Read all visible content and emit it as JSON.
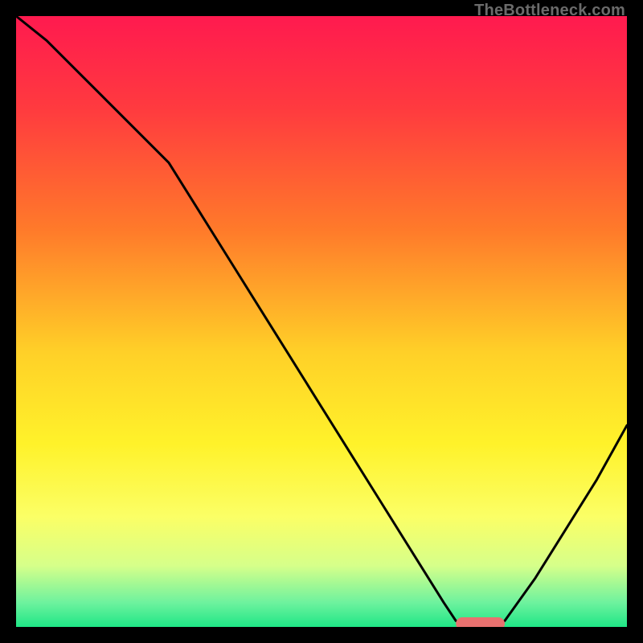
{
  "watermark": "TheBottleneck.com",
  "chart_data": {
    "type": "line",
    "title": "",
    "xlabel": "",
    "ylabel": "",
    "xlim": [
      0,
      100
    ],
    "ylim": [
      0,
      100
    ],
    "gradient_stops": [
      {
        "offset": 0.0,
        "color": "#ff1a4f"
      },
      {
        "offset": 0.15,
        "color": "#ff3a3f"
      },
      {
        "offset": 0.35,
        "color": "#ff7a2a"
      },
      {
        "offset": 0.55,
        "color": "#ffd028"
      },
      {
        "offset": 0.7,
        "color": "#fff22a"
      },
      {
        "offset": 0.82,
        "color": "#fbff66"
      },
      {
        "offset": 0.9,
        "color": "#d6ff8a"
      },
      {
        "offset": 0.96,
        "color": "#6ef29e"
      },
      {
        "offset": 1.0,
        "color": "#1fe686"
      }
    ],
    "series": [
      {
        "name": "bottleneck-curve",
        "color": "#000000",
        "x": [
          0,
          5,
          10,
          15,
          20,
          25,
          30,
          35,
          40,
          45,
          50,
          55,
          60,
          65,
          70,
          72,
          75,
          78,
          80,
          85,
          90,
          95,
          100
        ],
        "y": [
          100,
          96,
          91,
          86,
          81,
          76,
          68,
          60,
          52,
          44,
          36,
          28,
          20,
          12,
          4,
          1,
          0,
          0,
          1,
          8,
          16,
          24,
          33
        ]
      }
    ],
    "marker": {
      "name": "optimal-range",
      "shape": "pill",
      "color": "#e8716f",
      "x_start": 72,
      "x_end": 80,
      "y": 0
    }
  }
}
